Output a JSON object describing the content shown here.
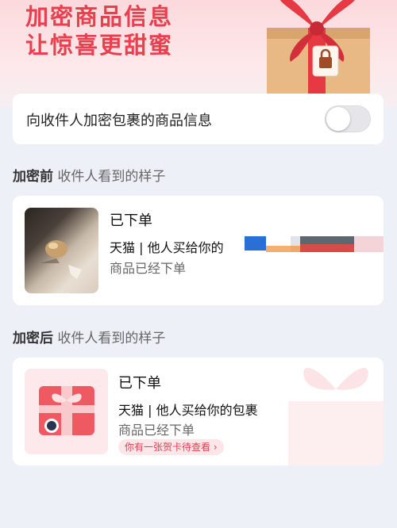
{
  "hero": {
    "title_line1": "加密商品信息",
    "title_line2": "让惊喜更甜蜜"
  },
  "toggle_setting": {
    "label": "向收件人加密包裹的商品信息",
    "enabled": false
  },
  "before_section": {
    "title_strong": "加密前",
    "title_rest": "收件人看到的样子",
    "order": {
      "status": "已下单",
      "title": "天猫 | 他人买给你的",
      "subtitle": "商品已经下单"
    }
  },
  "after_section": {
    "title_strong": "加密后",
    "title_rest": "收件人看到的样子",
    "order": {
      "status": "已下单",
      "title": "天猫 | 他人买给你的包裹",
      "subtitle": "商品已经下单",
      "card_tip": "你有一张贺卡待查看 ›"
    }
  },
  "colors": {
    "accent": "#ea3f4f",
    "background": "#eef0f8",
    "card": "#ffffff"
  }
}
